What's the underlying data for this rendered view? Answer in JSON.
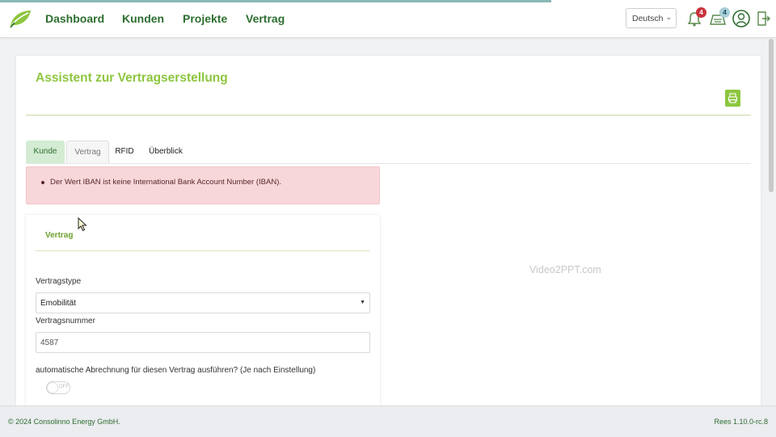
{
  "nav": {
    "items": [
      "Dashboard",
      "Kunden",
      "Projekte",
      "Vertrag"
    ],
    "language": "Deutsch",
    "notifications_count": "4",
    "tasks_count": "4",
    "icons": [
      "leaf-logo",
      "bell-icon",
      "tasks-icon",
      "user-icon",
      "logout-icon"
    ]
  },
  "page": {
    "title": "Assistent zur Vertragserstellung"
  },
  "tabs": [
    "Kunde",
    "Vertrag",
    "RFID",
    "Überblick"
  ],
  "alert": {
    "message": "Der Wert IBAN ist keine International Bank Account Number (IBAN)."
  },
  "form": {
    "section_title": "Vertrag",
    "vertragstype_label": "Vertragstype",
    "vertragstype_value": "Emobilität",
    "vertragsnummer_label": "Vertragsnummer",
    "vertragsnummer_value": "4587",
    "auto_billing_label": "automatische Abrechnung für diesen Vertrag ausführen? (Je nach Einstellung)",
    "auto_billing_state": "OFF"
  },
  "watermark": "Video2PPT.com",
  "footer": {
    "copyright": "© 2024 Consolinno Energy GmbH.",
    "version": "Rees 1.10.0-rc.8"
  },
  "colors": {
    "brand_green": "#8dc63f",
    "nav_green": "#2c6e2f",
    "alert_bg": "#f8d7da",
    "badge_red": "#c8323c"
  }
}
